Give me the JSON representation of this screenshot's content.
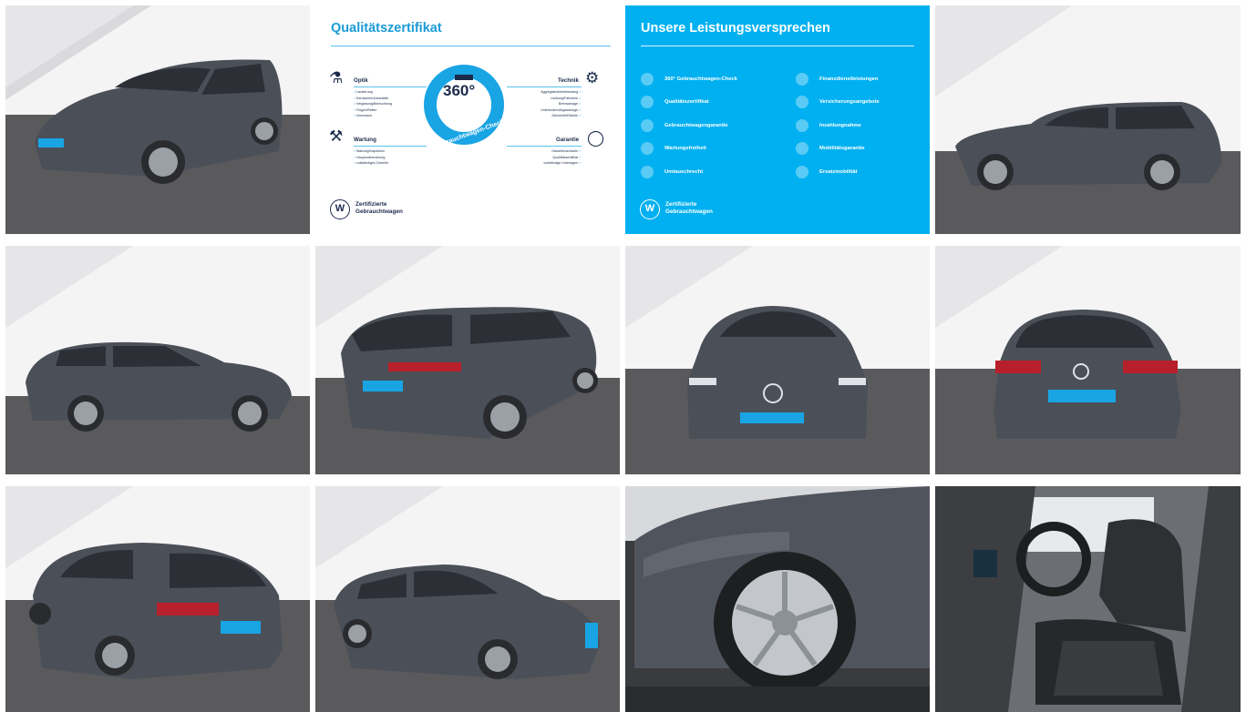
{
  "gallery": {
    "colors": {
      "brand_blue": "#00b0f0",
      "navy": "#1b2a4a",
      "car_grey": "#4d525b"
    },
    "tiles": [
      {
        "name": "photo-front-left"
      },
      {
        "name": "quality-certificate"
      },
      {
        "name": "service-promise"
      },
      {
        "name": "photo-side-left"
      },
      {
        "name": "photo-side-right"
      },
      {
        "name": "photo-rear-left"
      },
      {
        "name": "photo-front"
      },
      {
        "name": "photo-rear"
      },
      {
        "name": "photo-rear-quarter"
      },
      {
        "name": "photo-front-right"
      },
      {
        "name": "photo-wheel-detail"
      },
      {
        "name": "photo-interior-seats"
      }
    ]
  },
  "certificate": {
    "title": "Qualitätszertifikat",
    "badge": "360°",
    "badge_ring": "Gebrauchtwagen-Check",
    "sections": {
      "optik": {
        "title": "Optik",
        "items": [
          "Lackierung",
          "Karosserie/Anbauteile",
          "Verglasung/Beleuchtung",
          "Felgen/Reifen",
          "Innenraum"
        ]
      },
      "technik": {
        "title": "Technik",
        "items": [
          "Aggregate/Antriebsstrang",
          "Lenkung/Fahrwerk",
          "Bremsanlage",
          "Unterboden/Abgasanlage",
          "Sicherheit/Elektrik"
        ]
      },
      "wartung": {
        "title": "Wartung",
        "items": [
          "Wartung/Inspektion",
          "Hauptuntersuchung",
          "vollständiges Zubehör"
        ]
      },
      "garantie": {
        "title": "Garantie",
        "items": [
          "Garantienachweis",
          "Qualitätszertifikat",
          "vollständige Unterlagen"
        ]
      }
    },
    "footer": "Zertifizierte Gebrauchtwagen",
    "icons": [
      "car-inspection-icon",
      "tools-icon",
      "engine-check-icon",
      "shield-check-icon",
      "vw-logo-icon"
    ]
  },
  "promise": {
    "title": "Unsere Leistungsversprechen",
    "left_items": [
      "360° Gebrauchtwagen-Check",
      "Qualitätszertifikat",
      "Gebrauchtwagengarantie",
      "Wartungsfreiheit",
      "Umtauschrecht"
    ],
    "right_items": [
      "Finanzdienstleistungen",
      "Versicherungsangebote",
      "Inzahlungnahme",
      "Mobilitätsgarantie",
      "Ersatzmobilität"
    ],
    "footer": "Zertifizierte Gebrauchtwagen"
  }
}
